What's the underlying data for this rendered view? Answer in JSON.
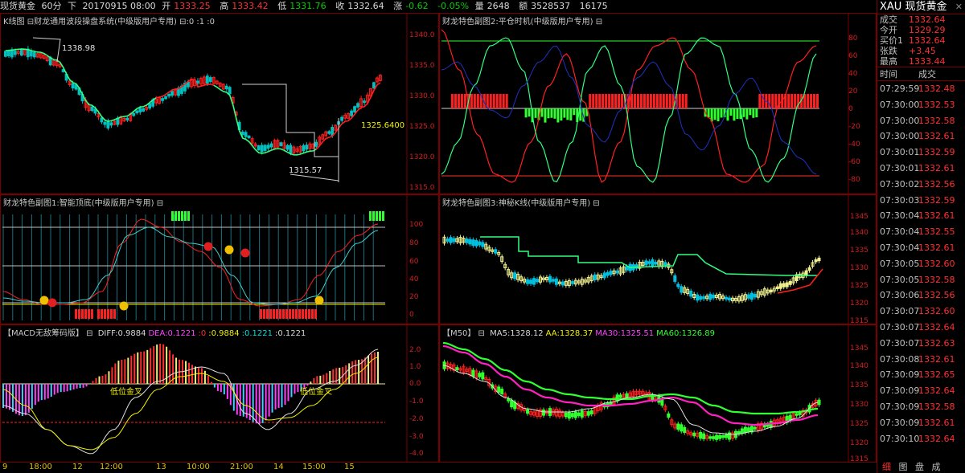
{
  "topbar": {
    "symbol": "现货黄金",
    "period": "60分",
    "arrow": "下",
    "datetime": "20170915 08:00",
    "open_label": "开",
    "open": "1333.25",
    "high_label": "高",
    "high": "1333.42",
    "low_label": "低",
    "low": "1331.76",
    "close_label": "收",
    "close": "1332.64",
    "chg_label": "涨",
    "chg": "-0.62",
    "chg_pct": "-0.05%",
    "vol_label": "量",
    "vol": "2648",
    "amt_label": "额",
    "amt": "3528537",
    "extra": "16175"
  },
  "panels": {
    "k": {
      "title": "K线图 ⊟财龙通用波段操盘系统(中级版用户专用) ⊟:0 :1 :0",
      "axis": [
        "1340.0",
        "1335.0",
        "1330.0",
        "1325.0",
        "1320.0",
        "1315.0"
      ],
      "hi_label": "1338.98",
      "lo_label": "1315.57",
      "last_label": "1325.6400"
    },
    "sub1": {
      "title": "财龙特色副图1:智能顶底(中级版用户专用) ⊟",
      "axis": [
        "100",
        "80",
        "60",
        "40",
        "20",
        "0"
      ]
    },
    "sub2": {
      "title": "财龙特色副图2:平仓时机(中级版用户专用) ⊟",
      "axis": [
        "80",
        "60",
        "40",
        "20",
        "0",
        "-20",
        "-40",
        "-60",
        "-80"
      ]
    },
    "sub3": {
      "title": "财龙特色副图3:神秘K线(中级版用户专用) ⊟",
      "axis": [
        "1345",
        "1340",
        "1335",
        "1330",
        "1325",
        "1320",
        "1315"
      ]
    },
    "macd": {
      "title": "【MACD无敌筹码版】 ⊟",
      "vals": [
        {
          "label": "DIFF:",
          "value": "0.9884",
          "color": "#d8d8d8"
        },
        {
          "label": "DEA:",
          "value": "0.1221",
          "color": "#ff40ff"
        },
        {
          "label": ":",
          "value": "0",
          "color": "#ff3030"
        },
        {
          "label": ":",
          "value": "0.9884",
          "color": "#f0f000"
        },
        {
          "label": ":",
          "value": "0.1221",
          "color": "#00e0e0"
        },
        {
          "label": ":",
          "value": "0.1221",
          "color": "#d8d8d8"
        }
      ],
      "axis": [
        "2.0",
        "1.0",
        "0.0",
        "-1.0",
        "-2.0",
        "-3.0",
        "-4.0"
      ],
      "ann1": "低位金叉",
      "ann2": "低位金叉"
    },
    "m50": {
      "title": "【M50】 ⊟",
      "vals": [
        {
          "label": "MA5:",
          "value": "1328.12",
          "color": "#d8d8d8"
        },
        {
          "label": "AA:",
          "value": "1328.37",
          "color": "#f0f000"
        },
        {
          "label": "MA30:",
          "value": "1325.51",
          "color": "#ff40ff"
        },
        {
          "label": "MA60:",
          "value": "1326.89",
          "color": "#30ff30"
        }
      ],
      "axis": [
        "1345",
        "1340",
        "1335",
        "1330",
        "1325",
        "1320",
        "1315"
      ]
    }
  },
  "bottom_axis": [
    "9",
    "18:00",
    "12",
    "12:00",
    "13",
    "10:00",
    "21:00",
    "14",
    "15:00",
    "15"
  ],
  "side": {
    "symbol": "XAU",
    "name": "现货黄金",
    "close_icon": "close-icon",
    "quote": [
      {
        "k": "成交",
        "v": "1332.64"
      },
      {
        "k": "今开",
        "v": "1329.29"
      },
      {
        "k": "买价1",
        "v": "1332.64"
      },
      {
        "k": "张跌",
        "v": "+3.45"
      },
      {
        "k": "最高",
        "v": "1333.44"
      }
    ],
    "col_time": "时间",
    "col_price": "成交",
    "ticks": [
      {
        "t": "07:29:59",
        "p": "1332.48"
      },
      {
        "t": "07:30:00",
        "p": "1332.53"
      },
      {
        "t": "07:30:00",
        "p": "1332.58"
      },
      {
        "t": "07:30:00",
        "p": "1332.61"
      },
      {
        "t": "07:30:01",
        "p": "1332.59"
      },
      {
        "t": "07:30:01",
        "p": "1332.61"
      },
      {
        "t": "07:30:02",
        "p": "1332.56"
      },
      {
        "t": "07:30:03",
        "p": "1332.59"
      },
      {
        "t": "07:30:04",
        "p": "1332.61"
      },
      {
        "t": "07:30:04",
        "p": "1332.55"
      },
      {
        "t": "07:30:04",
        "p": "1332.61"
      },
      {
        "t": "07:30:05",
        "p": "1332.60"
      },
      {
        "t": "07:30:05",
        "p": "1332.58"
      },
      {
        "t": "07:30:06",
        "p": "1332.56"
      },
      {
        "t": "07:30:07",
        "p": "1332.60"
      },
      {
        "t": "07:30:07",
        "p": "1332.64"
      },
      {
        "t": "07:30:07",
        "p": "1332.63"
      },
      {
        "t": "07:30:08",
        "p": "1332.61"
      },
      {
        "t": "07:30:09",
        "p": "1332.65"
      },
      {
        "t": "07:30:09",
        "p": "1332.64"
      },
      {
        "t": "07:30:09",
        "p": "1332.58"
      },
      {
        "t": "07:30:09",
        "p": "1332.61"
      },
      {
        "t": "07:30:10",
        "p": "1332.64"
      }
    ],
    "footer": [
      "细",
      "图",
      "盘",
      "成"
    ]
  }
}
